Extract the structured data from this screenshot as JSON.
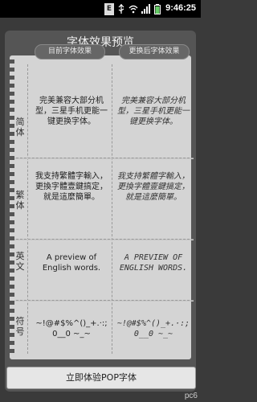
{
  "status_bar": {
    "time": "9:46:25",
    "icons": [
      "e-icon",
      "usb-icon",
      "wifi-icon",
      "signal-icon",
      "battery-icon"
    ]
  },
  "title": "字体效果预览",
  "columns": {
    "current": "目前字体效果",
    "changed": "更换后字体效果"
  },
  "rows": [
    {
      "label": "简\n体",
      "current": "完美兼容大部分机型，三星手机更能一键更换字体。",
      "changed": "完美兼容大部分机型，三星手机更能一键更换字体。"
    },
    {
      "label": "繁\n体",
      "current": "我支持繁體字輸入，更換字體壹鍵搞定，就是這麼簡單。",
      "changed": "我支持繁體字輸入，更換字體壹鍵搞定，就是這麼簡單。"
    },
    {
      "label": "英\n文",
      "current": "A preview of English words.",
      "changed": "A PREVIEW OF ENGLISH WORDS."
    },
    {
      "label": "符\n号",
      "current": "~!@#$%^()_+.·:; 0__0 ~_~",
      "changed": "~!@#$%^()_+.·:; 0__0 ~_~"
    }
  ],
  "button": "立即体验POP字体",
  "watermark": "pc6"
}
